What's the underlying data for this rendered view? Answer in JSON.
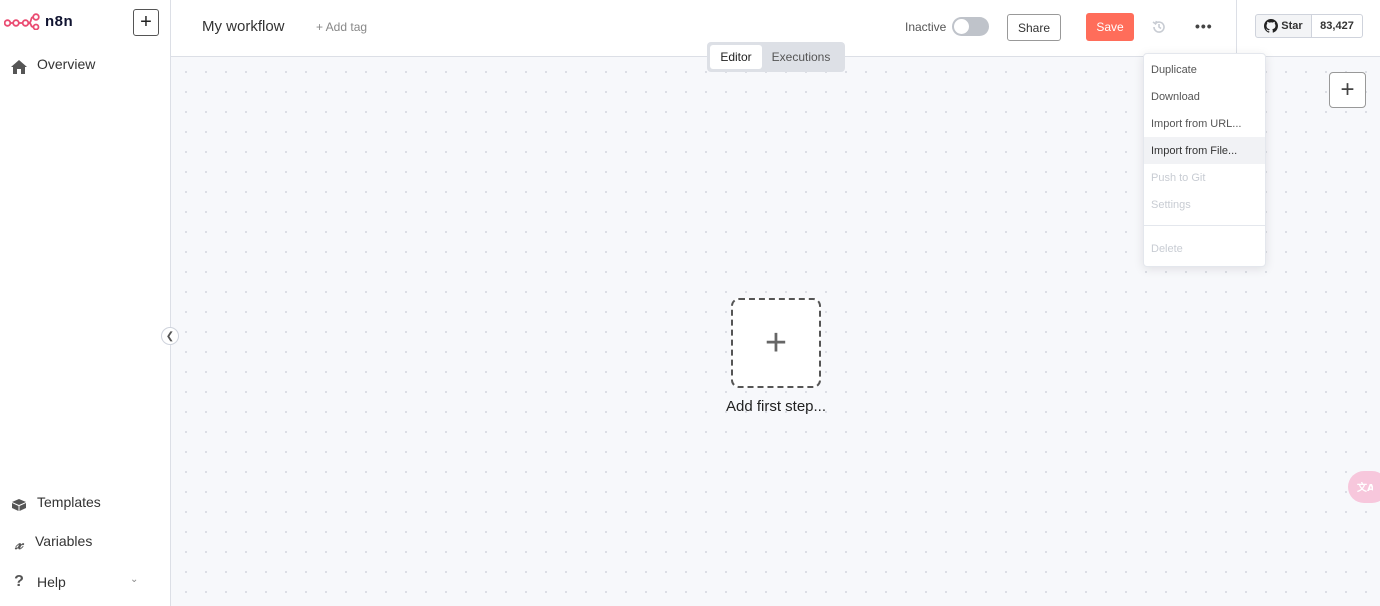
{
  "app": {
    "name": "n8n",
    "brand_color": "#ea4b71"
  },
  "sidebar": {
    "new_icon": "plus-icon",
    "items": [
      {
        "label": "Overview",
        "icon": "home-icon"
      },
      {
        "label": "Templates",
        "icon": "box-icon"
      },
      {
        "label": "Variables",
        "icon": "variable-icon"
      },
      {
        "label": "Help",
        "icon": "question-icon"
      }
    ]
  },
  "header": {
    "workflow_name": "My workflow",
    "add_tag": "+ Add tag",
    "inactive_label": "Inactive",
    "share_label": "Share",
    "save_label": "Save",
    "save_color": "#ff6d5a",
    "more_label": "•••",
    "github": {
      "star_label": "Star",
      "count": "83,427"
    }
  },
  "mode_tabs": [
    {
      "label": "Editor",
      "active": true
    },
    {
      "label": "Executions",
      "active": false
    }
  ],
  "canvas": {
    "add_first_step": "Add first step...",
    "zoom_plus_icon": "plus-icon",
    "translate_icon": "translate-icon"
  },
  "dropdown": {
    "items": [
      {
        "label": "Duplicate",
        "state": "enabled"
      },
      {
        "label": "Download",
        "state": "enabled"
      },
      {
        "label": "Import from URL...",
        "state": "enabled"
      },
      {
        "label": "Import from File...",
        "state": "hover"
      },
      {
        "label": "Push to Git",
        "state": "disabled"
      },
      {
        "label": "Settings",
        "state": "disabled"
      },
      {
        "label": "Delete",
        "state": "disabled"
      }
    ]
  }
}
